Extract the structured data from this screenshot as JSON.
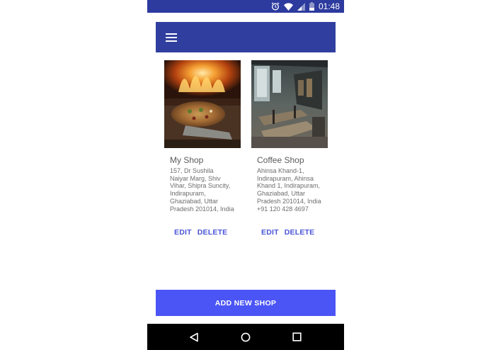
{
  "status_bar": {
    "time": "01:48",
    "icons": [
      "alarm-icon",
      "wifi-icon",
      "signal-icon",
      "battery-icon"
    ]
  },
  "toolbar": {
    "menu_icon": "hamburger-menu-icon"
  },
  "shops": [
    {
      "name": "My Shop",
      "address": "157, Dr Sushila\nNaiyar Marg, Shiv\nVihar, Shipra Suncity,\nIndirapuram,\nGhaziabad, Uttar\nPradesh 201014, India",
      "image": "pizza-oven-photo",
      "edit_label": "EDIT",
      "delete_label": "DELETE"
    },
    {
      "name": "Coffee Shop",
      "address": "Ahinsa Khand-1,\nIndirapuram, Ahinsa\nKhand 1, Indirapuram,\nGhaziabad, Uttar\nPradesh 201014, India\n+91 120 428 4697",
      "image": "cafe-interior-photo",
      "edit_label": "EDIT",
      "delete_label": "DELETE"
    }
  ],
  "add_button_label": "ADD NEW SHOP",
  "nav_bar": {
    "icons": [
      "back-icon",
      "home-icon",
      "recents-icon"
    ]
  },
  "colors": {
    "status_bar": "#2d3a9e",
    "toolbar": "#303f9f",
    "accent": "#4b55f5",
    "action_text": "#4a55d8"
  }
}
